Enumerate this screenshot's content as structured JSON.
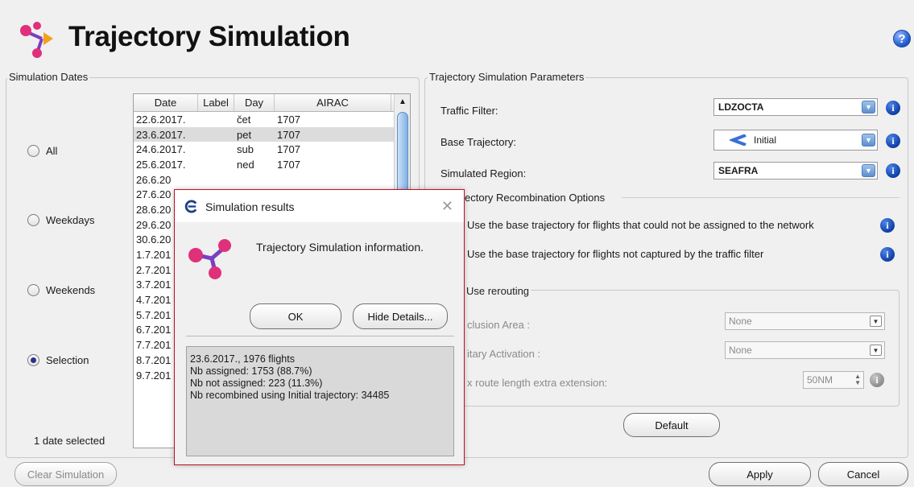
{
  "header": {
    "title": "Trajectory Simulation",
    "help_glyph": "?"
  },
  "dates": {
    "group_label": "Simulation Dates",
    "radios": [
      {
        "label": "All",
        "checked": false
      },
      {
        "label": "Weekdays",
        "checked": false
      },
      {
        "label": "Weekends",
        "checked": false
      },
      {
        "label": "Selection",
        "checked": true
      }
    ],
    "columns": [
      "Date",
      "Label",
      "Day",
      "AIRAC"
    ],
    "rows": [
      {
        "date": "22.6.2017.",
        "label": "",
        "day": "čet",
        "airac": "1707"
      },
      {
        "date": "23.6.2017.",
        "label": "",
        "day": "pet",
        "airac": "1707"
      },
      {
        "date": "24.6.2017.",
        "label": "",
        "day": "sub",
        "airac": "1707"
      },
      {
        "date": "25.6.2017.",
        "label": "",
        "day": "ned",
        "airac": "1707"
      },
      {
        "date": "26.6.20",
        "label": "",
        "day": "",
        "airac": ""
      },
      {
        "date": "27.6.20",
        "label": "",
        "day": "",
        "airac": ""
      },
      {
        "date": "28.6.20",
        "label": "",
        "day": "",
        "airac": ""
      },
      {
        "date": "29.6.20",
        "label": "",
        "day": "",
        "airac": ""
      },
      {
        "date": "30.6.20",
        "label": "",
        "day": "",
        "airac": ""
      },
      {
        "date": "1.7.201",
        "label": "",
        "day": "",
        "airac": ""
      },
      {
        "date": "2.7.201",
        "label": "",
        "day": "",
        "airac": ""
      },
      {
        "date": "3.7.201",
        "label": "",
        "day": "",
        "airac": ""
      },
      {
        "date": "4.7.201",
        "label": "",
        "day": "",
        "airac": ""
      },
      {
        "date": "5.7.201",
        "label": "",
        "day": "",
        "airac": ""
      },
      {
        "date": "6.7.201",
        "label": "",
        "day": "",
        "airac": ""
      },
      {
        "date": "7.7.201",
        "label": "",
        "day": "",
        "airac": ""
      },
      {
        "date": "8.7.201",
        "label": "",
        "day": "",
        "airac": ""
      },
      {
        "date": "9.7.201",
        "label": "",
        "day": "",
        "airac": ""
      }
    ],
    "status": "1 date selected",
    "clear_button": "Clear Simulation"
  },
  "params": {
    "group_label": "Trajectory Simulation Parameters",
    "traffic_filter": {
      "label": "Traffic Filter:",
      "value": "LDZOCTA"
    },
    "base_trajectory": {
      "label": "Base Trajectory:",
      "value": "Initial"
    },
    "simulated_region": {
      "label": "Simulated Region:",
      "value": "SEAFRA"
    },
    "recombination_title": "ectory Recombination Options",
    "option1": "Use the base trajectory for flights that could not be assigned to the network",
    "option2": "Use the base trajectory for flights not captured by the traffic filter",
    "rerouting": "Use rerouting",
    "exclusion_area": {
      "label": "clusion Area :",
      "value": "None"
    },
    "military_activation": {
      "label": "itary Activation :",
      "value": "None"
    },
    "max_route": {
      "label": "x route length extra extension:",
      "value": "50NM"
    },
    "default_button": "Default"
  },
  "footer": {
    "apply": "Apply",
    "cancel": "Cancel"
  },
  "dialog": {
    "title": "Simulation results",
    "close_glyph": "✕",
    "message": "Trajectory Simulation information.",
    "ok": "OK",
    "hide_details": "Hide Details...",
    "details": [
      "23.6.2017., 1976 flights",
      "Nb assigned: 1753 (88.7%)",
      "Nb not assigned: 223 (11.3%)",
      "Nb recombined using Initial trajectory: 34485"
    ]
  },
  "colors": {
    "accent": "#27348b",
    "info_blue": "#0f3ea6",
    "dialog_border": "#c01020",
    "logo_pink": "#e0307a",
    "logo_purple": "#7a3fc0"
  }
}
